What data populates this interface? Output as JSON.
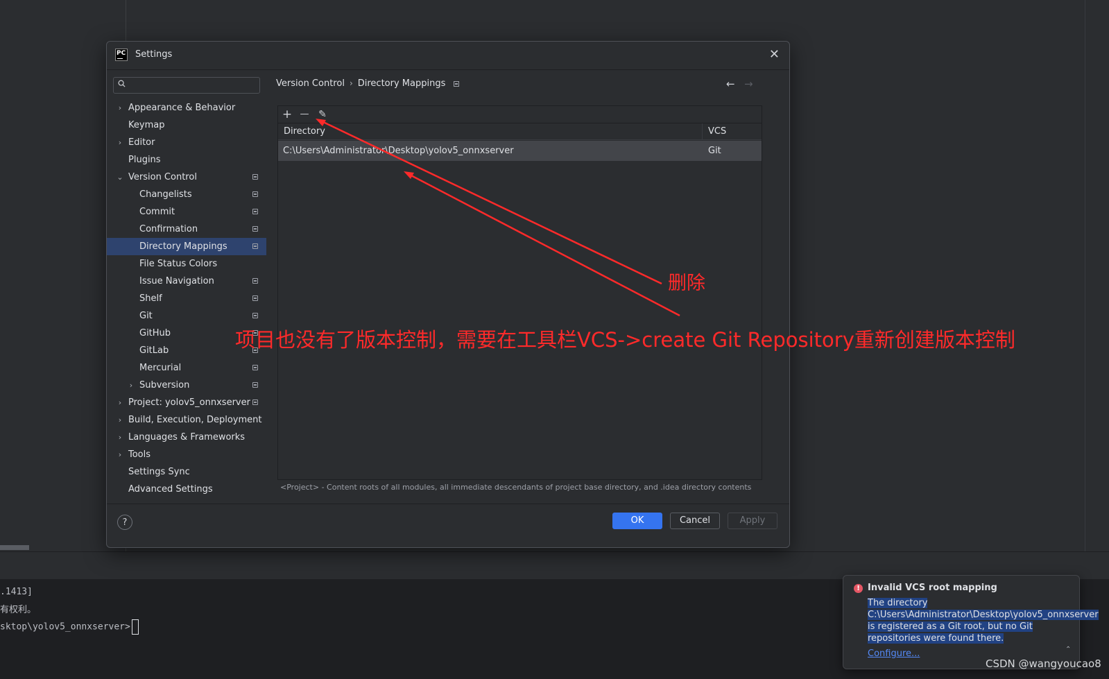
{
  "dialog": {
    "title": "Settings",
    "app_icon_text": "PC"
  },
  "sidebar": {
    "search_placeholder": "",
    "items": [
      {
        "label": "Appearance & Behavior",
        "expandable": true,
        "expanded": false,
        "level": 0
      },
      {
        "label": "Keymap",
        "expandable": false,
        "level": 0
      },
      {
        "label": "Editor",
        "expandable": true,
        "expanded": false,
        "level": 0
      },
      {
        "label": "Plugins",
        "expandable": false,
        "level": 0
      },
      {
        "label": "Version Control",
        "expandable": true,
        "expanded": true,
        "level": 0,
        "project_icon": true
      },
      {
        "label": "Changelists",
        "level": 1,
        "project_icon": true
      },
      {
        "label": "Commit",
        "level": 1,
        "project_icon": true
      },
      {
        "label": "Confirmation",
        "level": 1,
        "project_icon": true
      },
      {
        "label": "Directory Mappings",
        "level": 1,
        "project_icon": true,
        "selected": true
      },
      {
        "label": "File Status Colors",
        "level": 1
      },
      {
        "label": "Issue Navigation",
        "level": 1,
        "project_icon": true
      },
      {
        "label": "Shelf",
        "level": 1,
        "project_icon": true
      },
      {
        "label": "Git",
        "level": 1,
        "project_icon": true
      },
      {
        "label": "GitHub",
        "level": 1,
        "project_icon": true
      },
      {
        "label": "GitLab",
        "level": 1,
        "project_icon": true
      },
      {
        "label": "Mercurial",
        "level": 1,
        "project_icon": true
      },
      {
        "label": "Subversion",
        "level": 1,
        "expandable": true,
        "project_icon": true
      },
      {
        "label": "Project: yolov5_onnxserver",
        "expandable": true,
        "level": 0,
        "project_icon": true
      },
      {
        "label": "Build, Execution, Deployment",
        "expandable": true,
        "level": 0
      },
      {
        "label": "Languages & Frameworks",
        "expandable": true,
        "level": 0
      },
      {
        "label": "Tools",
        "expandable": true,
        "level": 0
      },
      {
        "label": "Settings Sync",
        "level": 0
      },
      {
        "label": "Advanced Settings",
        "level": 0
      }
    ]
  },
  "content": {
    "breadcrumb": [
      "Version Control",
      "Directory Mappings"
    ],
    "toolbar": {
      "add": "+",
      "remove": "—",
      "edit": "✎"
    },
    "table": {
      "columns": [
        "Directory",
        "VCS"
      ],
      "rows": [
        {
          "directory": "C:\\Users\\Administrator\\Desktop\\yolov5_onnxserver",
          "vcs": "Git"
        }
      ]
    },
    "footnote": "<Project> - Content roots of all modules, all immediate descendants of project base directory, and .idea directory contents"
  },
  "footer": {
    "help": "?",
    "ok": "OK",
    "cancel": "Cancel",
    "apply": "Apply"
  },
  "annotations": {
    "delete_label": "删除",
    "instruction": "项目也没有了版本控制，需要在工具栏VCS->create Git Repository重新创建版本控制",
    "color": "#ff2a2a"
  },
  "terminal": {
    "lines": [
      ".1413]",
      "有权利。",
      "",
      "sktop\\yolov5_onnxserver>"
    ]
  },
  "notification": {
    "title": "Invalid VCS root mapping",
    "body": "The directory C:\\Users\\Administrator\\Desktop\\yolov5_onnxserver is registered as a Git root, but no Git repositories were found there.",
    "link": "Configure..."
  },
  "watermark": "CSDN @wangyoucao8",
  "colors": {
    "selection": "#2e436e",
    "accent": "#3574f0",
    "error": "#e55765",
    "link": "#548af7"
  }
}
